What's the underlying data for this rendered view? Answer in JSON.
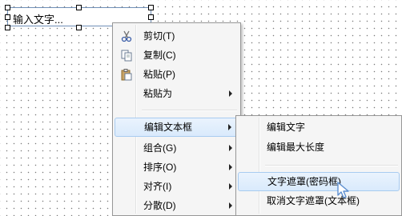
{
  "textbox": {
    "text": "输入文字..."
  },
  "context_menu": {
    "items": [
      {
        "label": "剪切(T)",
        "icon": "scissors-icon"
      },
      {
        "label": "复制(C)",
        "icon": "copy-icon"
      },
      {
        "label": "粘贴(P)",
        "icon": "paste-icon"
      },
      {
        "label": "粘贴为",
        "submenu": true
      },
      {
        "label": "编辑文本框",
        "submenu": true,
        "highlighted": true
      },
      {
        "label": "组合(G)",
        "submenu": true
      },
      {
        "label": "排序(O)",
        "submenu": true
      },
      {
        "label": "对齐(I)",
        "submenu": true
      },
      {
        "label": "分散(D)",
        "submenu": true
      }
    ]
  },
  "submenu": {
    "items": [
      {
        "label": "编辑文字"
      },
      {
        "label": "编辑最大长度"
      },
      {
        "label": "文字遮罩(密码框)",
        "highlighted": true
      },
      {
        "label": "取消文字遮罩(文本框)"
      }
    ]
  },
  "colors": {
    "highlight": "#d9eafc",
    "highlight_border": "#a8cbf0",
    "menu_bg": "#f5f5f5"
  }
}
